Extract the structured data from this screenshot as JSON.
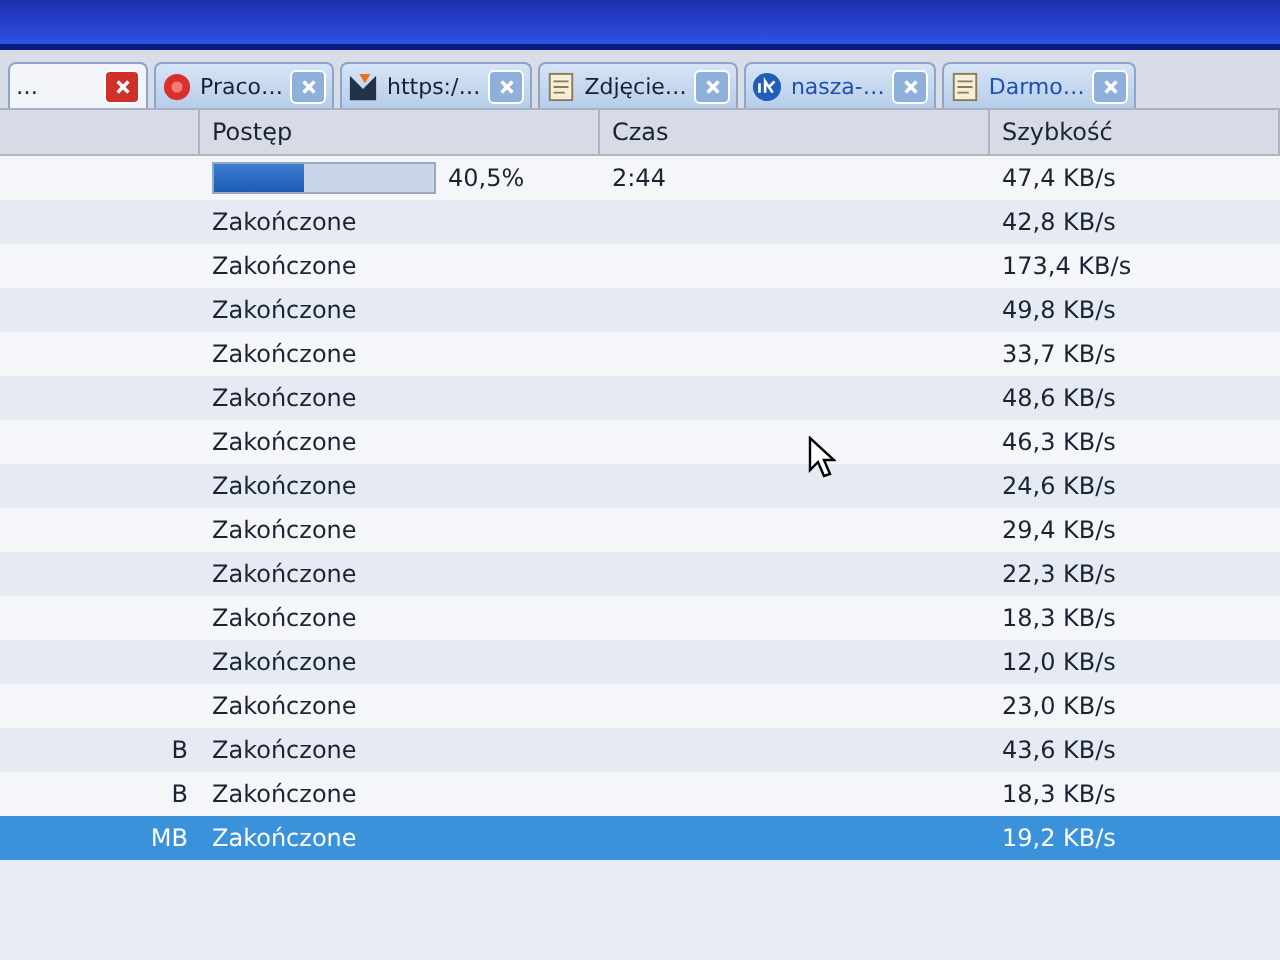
{
  "tabs": [
    {
      "label": "…",
      "kind": "plain",
      "selected": true
    },
    {
      "label": "Praco…",
      "kind": "flower",
      "selected": false
    },
    {
      "label": "https:/…",
      "kind": "logo",
      "selected": false
    },
    {
      "label": "Zdjęcie…",
      "kind": "page",
      "selected": false
    },
    {
      "label": "nasza-…",
      "kind": "badge",
      "selected": false
    },
    {
      "label": "Darmo…",
      "kind": "page",
      "selected": false
    }
  ],
  "table": {
    "columns": [
      "Postęp",
      "Czas",
      "Szybkość"
    ],
    "rows": [
      {
        "progress": {
          "kind": "bar",
          "level": 0.405,
          "text": "40,5%"
        },
        "time": "2:44",
        "speed": "47,4 KB/s",
        "selected": false
      },
      {
        "progress": {
          "kind": "text",
          "text": "Zakończone"
        },
        "speed": "42,8 KB/s",
        "selected": false
      },
      {
        "progress": {
          "kind": "text",
          "text": "Zakończone"
        },
        "speed": "173,4 KB/s",
        "selected": false
      },
      {
        "progress": {
          "kind": "text",
          "text": "Zakończone"
        },
        "speed": "49,8 KB/s",
        "selected": false
      },
      {
        "progress": {
          "kind": "text",
          "text": "Zakończone"
        },
        "speed": "33,7 KB/s",
        "selected": false
      },
      {
        "progress": {
          "kind": "text",
          "text": "Zakończone"
        },
        "speed": "48,6 KB/s",
        "selected": false
      },
      {
        "progress": {
          "kind": "text",
          "text": "Zakończone"
        },
        "speed": "46,3 KB/s",
        "selected": false
      },
      {
        "progress": {
          "kind": "text",
          "text": "Zakończone"
        },
        "speed": "24,6 KB/s",
        "selected": false
      },
      {
        "progress": {
          "kind": "text",
          "text": "Zakończone"
        },
        "speed": "29,4 KB/s",
        "selected": false
      },
      {
        "progress": {
          "kind": "text",
          "text": "Zakończone"
        },
        "speed": "22,3 KB/s",
        "selected": false
      },
      {
        "progress": {
          "kind": "text",
          "text": "Zakończone"
        },
        "speed": "18,3 KB/s",
        "selected": false
      },
      {
        "progress": {
          "kind": "text",
          "text": "Zakończone"
        },
        "speed": "12,0 KB/s",
        "selected": false
      },
      {
        "progress": {
          "kind": "text",
          "text": "Zakończone"
        },
        "speed": "23,0 KB/s",
        "selected": false
      },
      {
        "progress": {
          "kind": "text",
          "text": "Zakończone"
        },
        "column_1": "B",
        "speed": "43,6 KB/s",
        "selected": false
      },
      {
        "progress": {
          "kind": "text",
          "text": "Zakończone"
        },
        "column_1": "B",
        "speed": "18,3 KB/s",
        "selected": false
      },
      {
        "progress": {
          "kind": "text",
          "text": "Zakończone"
        },
        "column_1": "MB",
        "speed": "19,2 KB/s",
        "selected": true
      }
    ]
  }
}
